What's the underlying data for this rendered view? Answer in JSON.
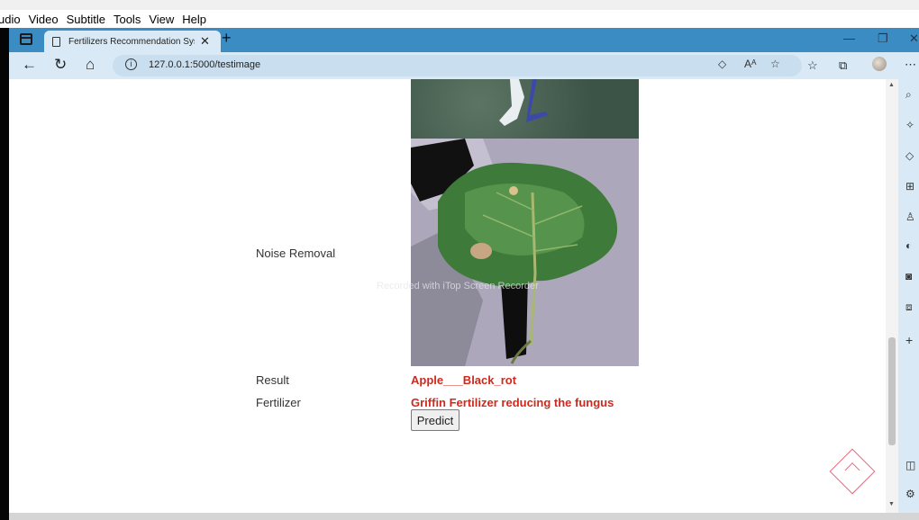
{
  "menubar": {
    "items": [
      "udio",
      "Video",
      "Subtitle",
      "Tools",
      "View",
      "Help"
    ]
  },
  "browser": {
    "tab_title": "Fertilizers Recommendation Syst",
    "url": "127.0.0.1:5000/testimage",
    "read_aloud_label": "Aᴬ"
  },
  "page": {
    "noise_removal_label": "Noise Removal",
    "result_label": "Result",
    "result_value": "Apple___Black_rot",
    "fertilizer_label": "Fertilizer",
    "fertilizer_value": "Griffin Fertilizer reducing the fungus",
    "predict_button": "Predict",
    "watermark": "Recorded with iTop Screen Recorder"
  },
  "colors": {
    "accent_tabstrip": "#3c8cc4",
    "result_text": "#d0291c"
  }
}
